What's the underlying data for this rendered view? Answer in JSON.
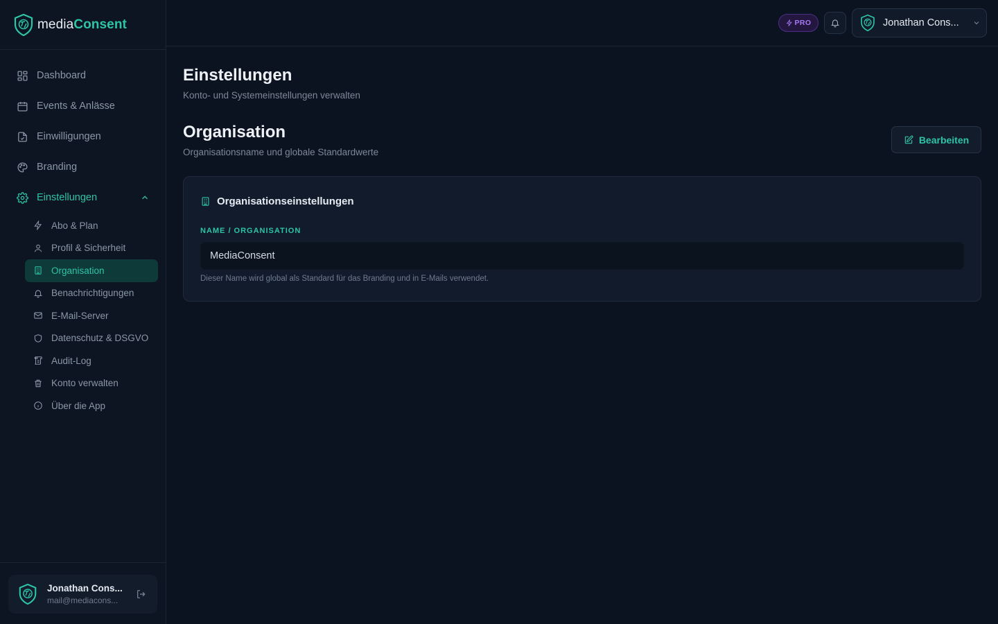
{
  "brand": {
    "part1": "media",
    "part2": "Consent"
  },
  "nav": {
    "items": [
      {
        "label": "Dashboard",
        "icon": "dashboard-icon"
      },
      {
        "label": "Events & Anlässe",
        "icon": "calendar-icon"
      },
      {
        "label": "Einwilligungen",
        "icon": "file-check-icon"
      },
      {
        "label": "Branding",
        "icon": "palette-icon"
      },
      {
        "label": "Einstellungen",
        "icon": "gear-icon",
        "active": true,
        "expanded": true
      }
    ],
    "sub_items": [
      {
        "label": "Abo & Plan",
        "icon": "bolt-icon"
      },
      {
        "label": "Profil & Sicherheit",
        "icon": "user-icon"
      },
      {
        "label": "Organisation",
        "icon": "building-icon",
        "active": true
      },
      {
        "label": "Benachrichtigungen",
        "icon": "bell-icon"
      },
      {
        "label": "E-Mail-Server",
        "icon": "mail-icon"
      },
      {
        "label": "Datenschutz & DSGVO",
        "icon": "shield-icon"
      },
      {
        "label": "Audit-Log",
        "icon": "scroll-icon"
      },
      {
        "label": "Konto verwalten",
        "icon": "trash-icon"
      },
      {
        "label": "Über die App",
        "icon": "info-icon"
      }
    ]
  },
  "sidebar_user": {
    "name": "Jonathan Cons...",
    "email": "mail@mediacons..."
  },
  "topbar": {
    "badge": "PRO",
    "user_name": "Jonathan Cons..."
  },
  "page": {
    "title": "Einstellungen",
    "subtitle": "Konto- und Systemeinstellungen verwalten",
    "section_title": "Organisation",
    "section_subtitle": "Organisationsname und globale Standardwerte",
    "edit_label": "Bearbeiten"
  },
  "card": {
    "title": "Organisationseinstellungen",
    "field_label": "NAME / ORGANISATION",
    "field_value": "MediaConsent",
    "field_help": "Dieser Name wird global als Standard für das Branding und in E-Mails verwendet."
  },
  "colors": {
    "accent": "#2ec4a6",
    "pro": "#a77af5",
    "background": "#0c1320"
  }
}
